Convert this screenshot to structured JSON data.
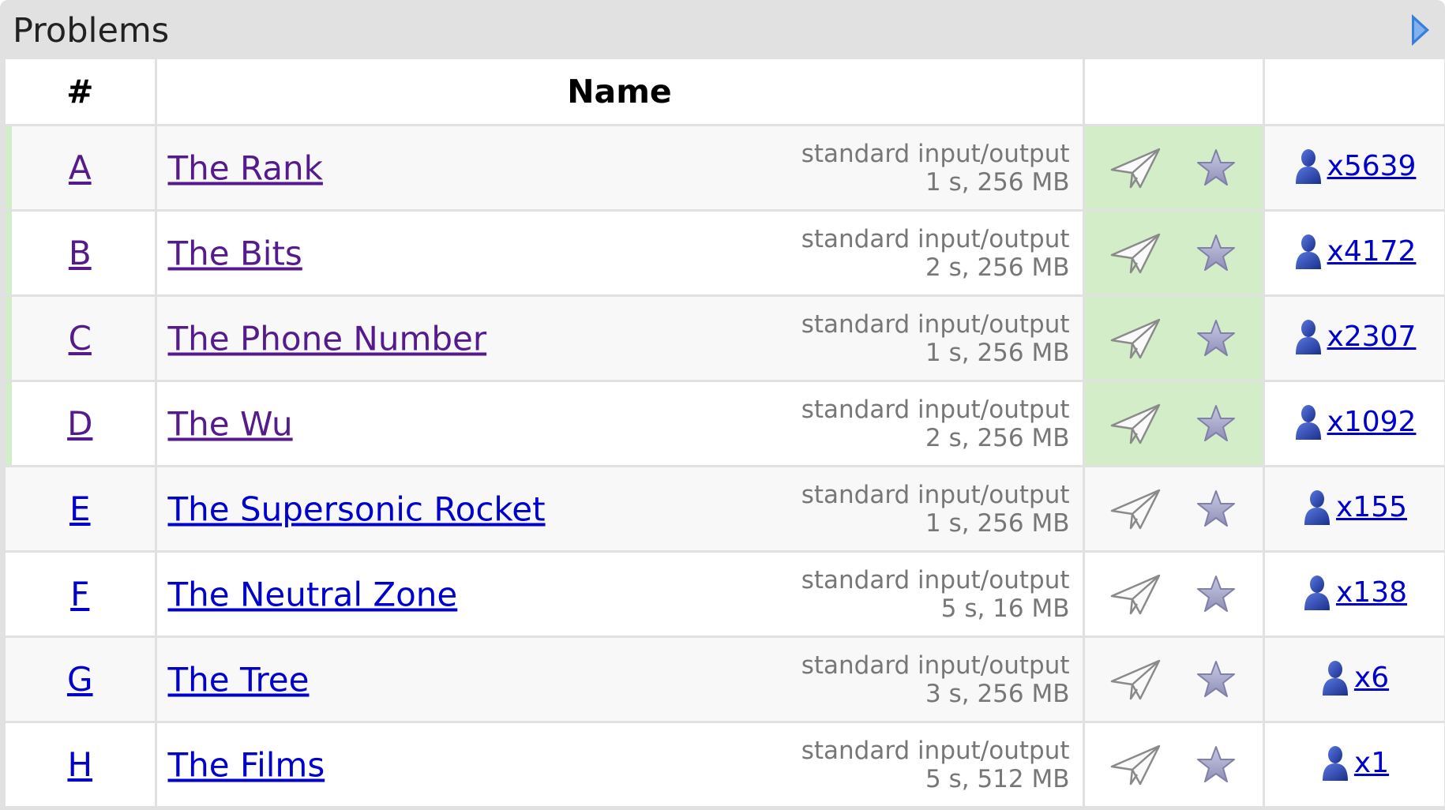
{
  "panel": {
    "title": "Problems"
  },
  "table": {
    "headers": {
      "index": "#",
      "name": "Name"
    },
    "rows": [
      {
        "index": "A",
        "name": "The Rank",
        "io": "standard input/output",
        "limits": "1 s, 256 MB",
        "solvers": "x5639",
        "accepted": true
      },
      {
        "index": "B",
        "name": "The Bits",
        "io": "standard input/output",
        "limits": "2 s, 256 MB",
        "solvers": "x4172",
        "accepted": true
      },
      {
        "index": "C",
        "name": "The Phone Number",
        "io": "standard input/output",
        "limits": "1 s, 256 MB",
        "solvers": "x2307",
        "accepted": true
      },
      {
        "index": "D",
        "name": "The Wu",
        "io": "standard input/output",
        "limits": "2 s, 256 MB",
        "solvers": "x1092",
        "accepted": true
      },
      {
        "index": "E",
        "name": "The Supersonic Rocket",
        "io": "standard input/output",
        "limits": "1 s, 256 MB",
        "solvers": "x155",
        "accepted": false
      },
      {
        "index": "F",
        "name": "The Neutral Zone",
        "io": "standard input/output",
        "limits": "5 s, 16 MB",
        "solvers": "x138",
        "accepted": false
      },
      {
        "index": "G",
        "name": "The Tree",
        "io": "standard input/output",
        "limits": "3 s, 256 MB",
        "solvers": "x6",
        "accepted": false
      },
      {
        "index": "H",
        "name": "The Films",
        "io": "standard input/output",
        "limits": "5 s, 512 MB",
        "solvers": "x1",
        "accepted": false
      }
    ]
  },
  "icons": {
    "collapse": "collapse-arrow-icon",
    "submit": "paper-plane-icon",
    "favourite": "star-icon",
    "solvers": "user-icon"
  },
  "colors": {
    "accepted_bg": "#d4edc9",
    "link": "#0000cc",
    "visited_link": "#551a8b",
    "limits_text": "#777777"
  }
}
